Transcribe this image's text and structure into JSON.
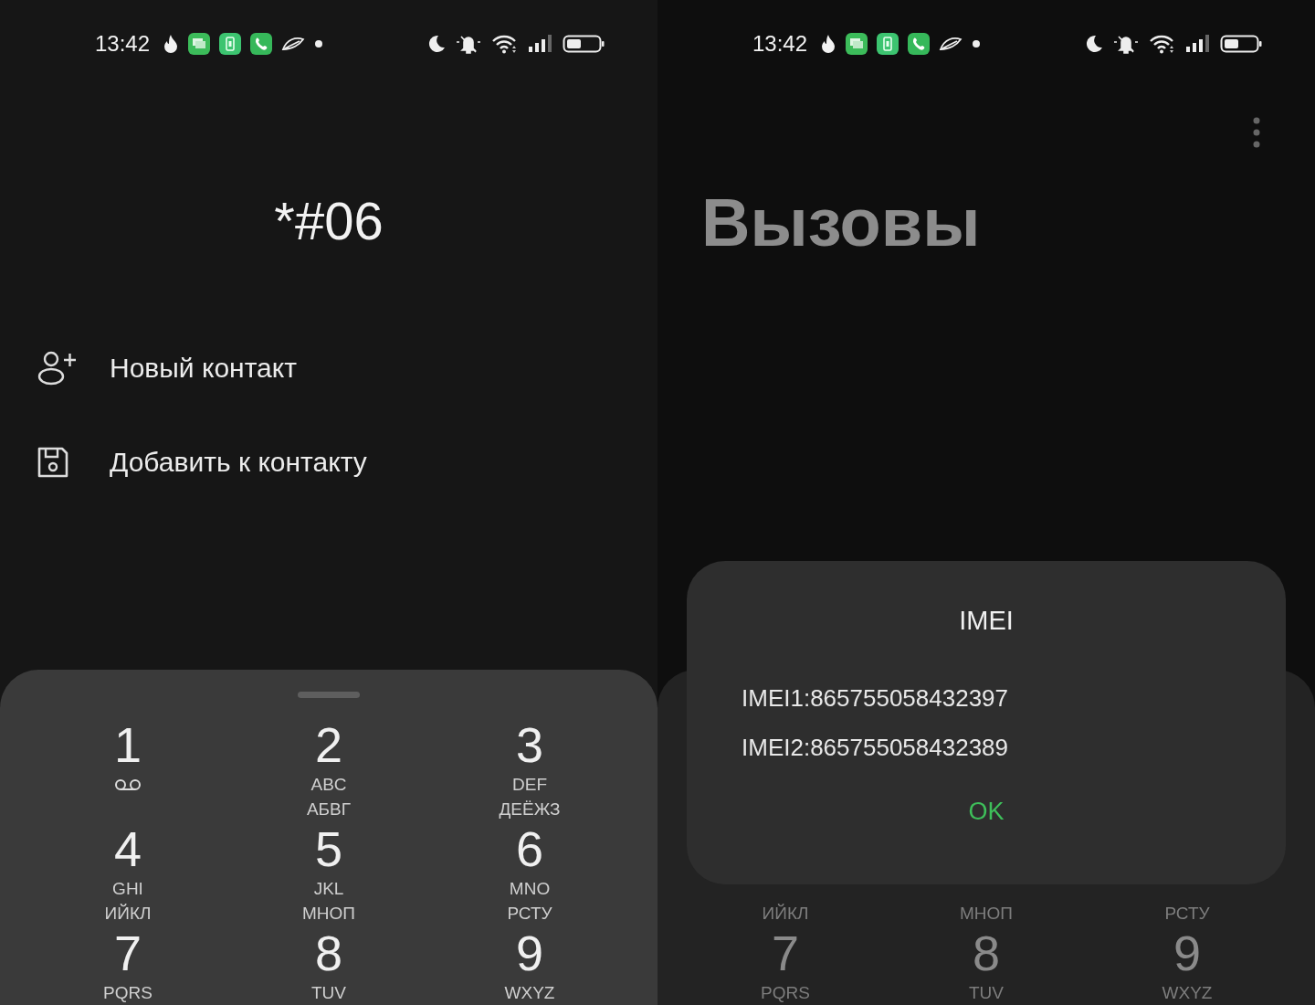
{
  "left_screen": {
    "status_bar": {
      "time": "13:42"
    },
    "dialed_number": "*#06",
    "actions": [
      {
        "kind": "new-contact",
        "label": "Новый контакт"
      },
      {
        "kind": "add-to-contact",
        "label": "Добавить к контакту"
      }
    ],
    "keypad": {
      "keys": [
        {
          "digit": "1",
          "kind": "voicemail"
        },
        {
          "digit": "2",
          "letters": [
            "ABC",
            "АБВГ"
          ]
        },
        {
          "digit": "3",
          "letters": [
            "DEF",
            "ДЕЁЖЗ"
          ]
        },
        {
          "digit": "4",
          "letters": [
            "GHI",
            "ИЙКЛ"
          ]
        },
        {
          "digit": "5",
          "letters": [
            "JKL",
            "МНОП"
          ]
        },
        {
          "digit": "6",
          "letters": [
            "MNO",
            "РСТУ"
          ]
        },
        {
          "digit": "7",
          "letters": [
            "PQRS"
          ]
        },
        {
          "digit": "8",
          "letters": [
            "TUV"
          ]
        },
        {
          "digit": "9",
          "letters": [
            "WXYZ"
          ]
        }
      ]
    }
  },
  "right_screen": {
    "status_bar": {
      "time": "13:42"
    },
    "title": "Вызовы",
    "keypad": {
      "keys": [
        {
          "letters": [
            "ИЙКЛ"
          ]
        },
        {
          "letters": [
            "МНОП"
          ]
        },
        {
          "letters": [
            "РСТУ"
          ]
        },
        {
          "digit": "7",
          "letters": [
            "PQRS"
          ]
        },
        {
          "digit": "8",
          "letters": [
            "TUV"
          ]
        },
        {
          "digit": "9",
          "letters": [
            "WXYZ"
          ]
        }
      ]
    },
    "dialog": {
      "title": "IMEI",
      "lines": [
        "IMEI1:865755058432397",
        "IMEI2:865755058432389"
      ],
      "button": "OK"
    }
  }
}
